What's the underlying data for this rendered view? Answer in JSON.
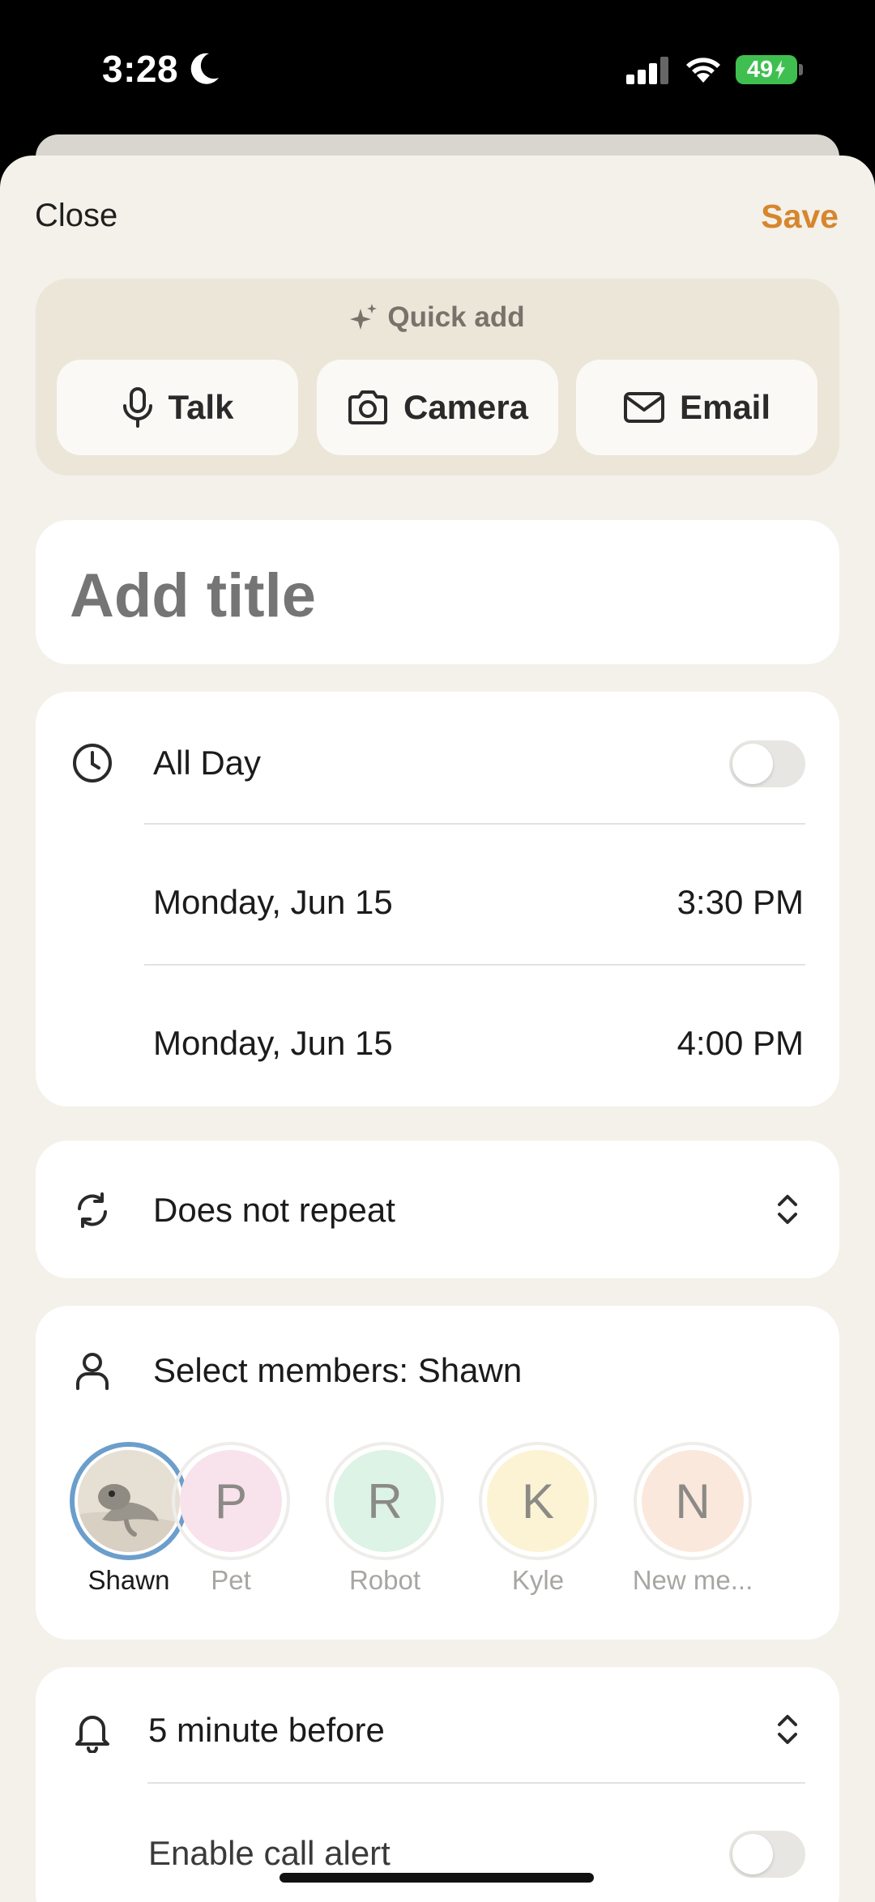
{
  "status": {
    "time": "3:28",
    "battery": "49"
  },
  "header": {
    "close_label": "Close",
    "save_label": "Save"
  },
  "quick_add": {
    "title": "Quick add",
    "buttons": [
      {
        "label": "Talk",
        "icon": "microphone-icon"
      },
      {
        "label": "Camera",
        "icon": "camera-icon"
      },
      {
        "label": "Email",
        "icon": "mail-icon"
      }
    ]
  },
  "title_field": {
    "placeholder": "Add title",
    "value": ""
  },
  "time": {
    "all_day_label": "All Day",
    "all_day_on": false,
    "start": {
      "date": "Monday, Jun 15",
      "time": "3:30 PM"
    },
    "end": {
      "date": "Monday, Jun 15",
      "time": "4:00 PM"
    }
  },
  "repeat": {
    "label": "Does not repeat"
  },
  "members": {
    "label": "Select members: Shawn",
    "items": [
      {
        "name": "Shawn",
        "initial": "",
        "color": "#e9e4da",
        "selected": true
      },
      {
        "name": "Pet",
        "initial": "P",
        "color": "#f8e3ec",
        "selected": false
      },
      {
        "name": "Robot",
        "initial": "R",
        "color": "#dcf3e6",
        "selected": false
      },
      {
        "name": "Kyle",
        "initial": "K",
        "color": "#fbf3d3",
        "selected": false
      },
      {
        "name": "New me...",
        "initial": "N",
        "color": "#fbe8dc",
        "selected": false
      }
    ]
  },
  "alert": {
    "reminder_label": "5 minute before",
    "call_alert_label": "Enable call alert",
    "call_alert_on": false
  },
  "colors": {
    "accent": "#d6862d",
    "selected_ring": "#6c9ecb",
    "background": "#f4f1ea"
  }
}
